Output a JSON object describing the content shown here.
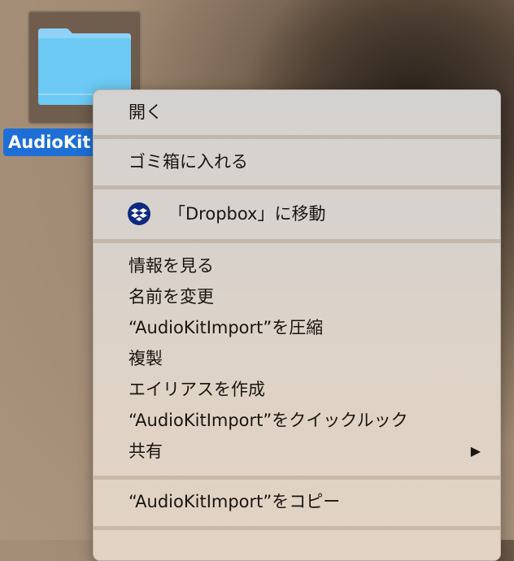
{
  "desktop": {
    "selected_item_label": "AudioKit"
  },
  "menu": {
    "open": "開く",
    "trash": "ゴミ箱に入れる",
    "dropbox": "「Dropbox」に移動",
    "info": "情報を見る",
    "rename": "名前を変更",
    "compress": "“AudioKitImport”を圧縮",
    "duplicate": "複製",
    "alias": "エイリアスを作成",
    "quicklook": "“AudioKitImport”をクイックルック",
    "share": "共有",
    "share_arrow": "▶",
    "copy": "“AudioKitImport”をコピー"
  },
  "colors": {
    "selection": "#1d6fd6",
    "dropbox": "#0d2a80"
  }
}
